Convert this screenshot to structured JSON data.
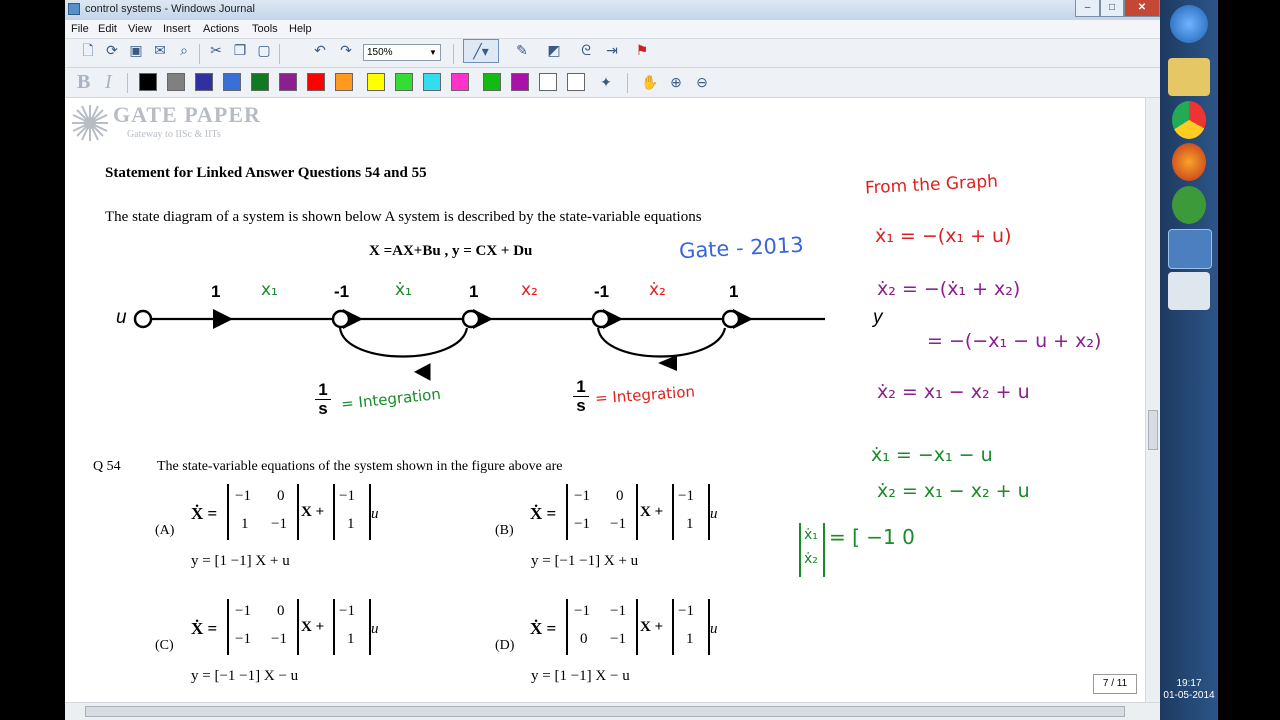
{
  "window": {
    "title": "control systems - Windows Journal",
    "min": "–",
    "max": "□",
    "close": "✕"
  },
  "menu": [
    "File",
    "Edit",
    "View",
    "Insert",
    "Actions",
    "Tools",
    "Help"
  ],
  "toolbar": {
    "zoom": "150%"
  },
  "palette": [
    "#000000",
    "#808080",
    "#3030a0",
    "#3a6fd8",
    "#0f7a1f",
    "#8a1f8f",
    "#ff0000",
    "#ff9a1f",
    "#ffff00",
    "#33dd33",
    "#33ddee",
    "#ff33cc",
    "#11bb11",
    "#aa11aa",
    "#ffffff",
    "#ffffff"
  ],
  "logo": {
    "name": "GATE PAPER",
    "tagline": "Gateway to IISc & IITs"
  },
  "problem": {
    "heading": "Statement for Linked Answer Questions 54 and 55",
    "intro": "The state diagram of a system is shown below  A system is  described by the state-variable equations",
    "equation": "X =AX+Bu ,     y = CX + Du",
    "diagram": {
      "input": "u",
      "output": "y",
      "gain1": "1",
      "gain2": "-1",
      "gain3": "1",
      "gain4": "-1",
      "gain5": "1",
      "integrator_num": "1",
      "integrator_den": "s"
    },
    "question_no": "Q 54",
    "question": "The state-variable equations of the system shown in the figure above are",
    "options": [
      {
        "label": "(A)",
        "A": [
          [
            "−1",
            "0"
          ],
          [
            "1",
            "−1"
          ]
        ],
        "B": [
          "−1",
          "1"
        ],
        "y": "y = [1   −1] X + u"
      },
      {
        "label": "(B)",
        "A": [
          [
            "−1",
            "0"
          ],
          [
            "−1",
            "−1"
          ]
        ],
        "B": [
          "−1",
          "1"
        ],
        "y": "y = [−1   −1] X + u"
      },
      {
        "label": "(C)",
        "A": [
          [
            "−1",
            "0"
          ],
          [
            "−1",
            "−1"
          ]
        ],
        "B": [
          "−1",
          "1"
        ],
        "y": "y = [−1   −1] X − u"
      },
      {
        "label": "(D)",
        "A": [
          [
            "−1",
            "−1"
          ],
          [
            "0",
            "−1"
          ]
        ],
        "B": [
          "−1",
          "1"
        ],
        "y": "y = [1   −1] X − u"
      }
    ]
  },
  "annotations": {
    "gate": "Gate - 2013",
    "x1": "x₁",
    "x1dot": "ẋ₁",
    "x2": "x₂",
    "x2dot": "ẋ₂",
    "integ1": "= Integration",
    "integ2": "= Integration",
    "from_graph": "From the Graph",
    "eq1": "ẋ₁ = −(x₁ + u)",
    "eq2": "ẋ₂ = −(ẋ₁ + x₂)",
    "eq3": "= −(−x₁ − u + x₂)",
    "eq4": "ẋ₂ = x₁ − x₂ + u",
    "eq5": "ẋ₁ = −x₁ − u",
    "eq6": "ẋ₂ = x₁ − x₂ + u",
    "matrix_lhs1": "ẋ₁",
    "matrix_lhs2": "ẋ₂",
    "matrix_rhs": "= [ −1  0"
  },
  "page_indicator": "7 / 11",
  "clock": {
    "time": "19:17",
    "date": "01-05-2014"
  }
}
